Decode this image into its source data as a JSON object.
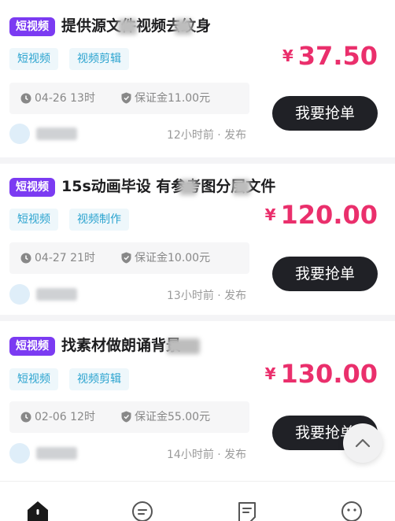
{
  "tasks": [
    {
      "category": "短视频",
      "title": "提供源文件视频去纹身",
      "tags": [
        "短视频",
        "视频剪辑"
      ],
      "currency": "¥",
      "price": "37.50",
      "deadline": "04-26 13时",
      "deposit": "保证金11.00元",
      "button_label": "我要抢单",
      "posted": "12小时前 · 发布"
    },
    {
      "category": "短视频",
      "title": "15s动画毕设 有参考图分层文件",
      "tags": [
        "短视频",
        "视频制作"
      ],
      "currency": "¥",
      "price": "120.00",
      "deadline": "04-27 21时",
      "deposit": "保证金10.00元",
      "button_label": "我要抢单",
      "posted": "13小时前 · 发布"
    },
    {
      "category": "短视频",
      "title": "找素材做朗诵背景",
      "tags": [
        "短视频",
        "视频剪辑"
      ],
      "currency": "¥",
      "price": "130.00",
      "deadline": "02-06 12时",
      "deposit": "保证金55.00元",
      "button_label": "我要抢单",
      "posted": "14小时前 · 发布"
    }
  ],
  "bottom_nav": {
    "icons": [
      "home-icon",
      "message-icon",
      "document-icon",
      "profile-icon"
    ]
  },
  "colors": {
    "badge": "#7b3bf2",
    "price": "#ea2f6c",
    "tag_text": "#2aa3cf",
    "tag_bg": "#eef7fb",
    "button": "#202126"
  }
}
